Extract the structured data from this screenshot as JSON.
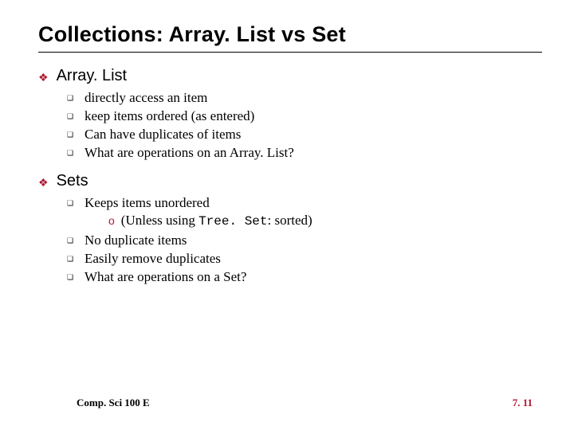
{
  "title": "Collections: Array. List vs Set",
  "sections": [
    {
      "label": "Array. List",
      "items": [
        {
          "text": "directly access an item"
        },
        {
          "text": "keep items ordered (as entered)"
        },
        {
          "text": "Can have duplicates of items"
        },
        {
          "text": "What are operations on an Array. List?"
        }
      ]
    },
    {
      "label": "Sets",
      "items": [
        {
          "text": "Keeps items unordered",
          "sub": {
            "prefix": "(Unless using ",
            "mono": "Tree. Set",
            "suffix": ": sorted)"
          }
        },
        {
          "text": "No duplicate items"
        },
        {
          "text": "Easily remove duplicates"
        },
        {
          "text": "What are operations on a Set?"
        }
      ]
    }
  ],
  "footer": {
    "course": "Comp. Sci 100 E",
    "page": "7. 11"
  },
  "bullets": {
    "diamond": "❖",
    "square": "❑",
    "circle": "o"
  }
}
